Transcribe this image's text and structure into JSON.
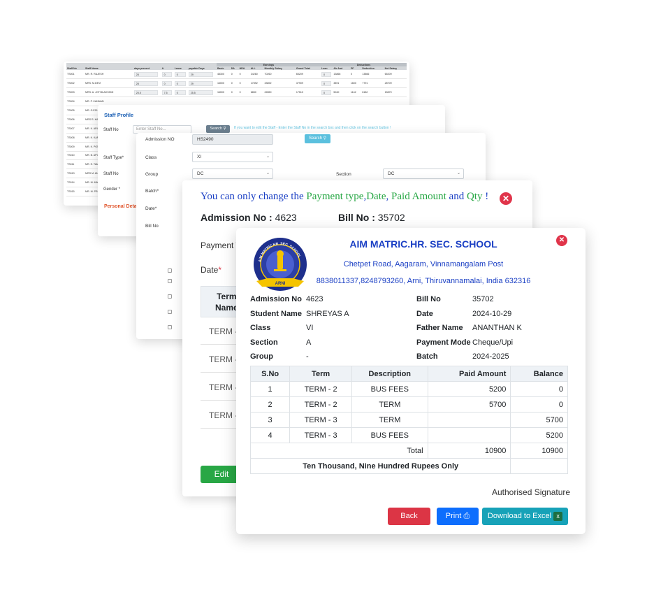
{
  "salary_table": {
    "group_earnings": "Earnings",
    "group_deductions": "Deductions",
    "columns": [
      "Staff No",
      "Staff Name",
      "days present",
      "A",
      "Leave",
      "payable Days",
      "Basic",
      "DA",
      "HRA",
      "ALL",
      "Monthly Salary",
      "Grand Total",
      "Loan",
      "Alr Amt",
      "PF",
      "Deduction",
      "Net Salary"
    ],
    "rows": [
      {
        "no": "TS001",
        "name": "MR. R. RAJESH",
        "present": "28",
        "a": "0",
        "leave": "0",
        "payable": "29",
        "basic": "48300",
        "da": "0",
        "hra": "0",
        "all": "34260",
        "monthly": "70260",
        "grand": "65209",
        "loan": "0",
        "alr": "13866",
        "pf": "0",
        "ded": "13866",
        "net": "65209"
      },
      {
        "no": "TS002",
        "name": "MRS. M.DEVI",
        "present": "28",
        "a": "0",
        "leave": "0",
        "payable": "29",
        "basic": "16000",
        "da": "0",
        "hra": "0",
        "all": "17892",
        "monthly": "33892",
        "grand": "37909",
        "loan": "0",
        "alr": "3891",
        "pf": "1600",
        "ded": "7791",
        "net": "28709"
      },
      {
        "no": "TS003",
        "name": "MRS. A. JOTHILAKSHMI",
        "present": "25.5",
        "a": "7.5",
        "leave": "0",
        "payable": "25.5",
        "basic": "16000",
        "da": "0",
        "hra": "0",
        "all": "6850",
        "monthly": "22850",
        "grand": "17510",
        "loan": "0",
        "alr": "5040",
        "pf": "1142",
        "ded": "6182",
        "net": "15870"
      },
      {
        "no": "TS004",
        "name": "MR. P. KANNAN"
      },
      {
        "no": "TS005",
        "name": "MR. G.EZHIL"
      },
      {
        "no": "TS006",
        "name": "MRS R. KAVITHA"
      },
      {
        "no": "TS007",
        "name": "MR. K. ARUN"
      },
      {
        "no": "TS008",
        "name": "MR. K. KARTHI"
      },
      {
        "no": "TS009",
        "name": "MR. K. PONNAN"
      },
      {
        "no": "TS010",
        "name": "MR. B. APOORVA"
      },
      {
        "no": "TS011",
        "name": "MR. E. TAMIL"
      },
      {
        "no": "TS013",
        "name": "MRS M. ANU"
      },
      {
        "no": "TS014",
        "name": "MR. M. MANI"
      },
      {
        "no": "TS015",
        "name": "MR. M. PRAKASH"
      }
    ]
  },
  "staff_profile": {
    "title": "Staff Profile",
    "staff_no_label": "Staff No",
    "staff_no_placeholder": "Enter Staff No...",
    "search_label": "Search",
    "hint": "If you want to edit the Staff - Enter the Staff No in the search box and then click on the search button !",
    "staff_type_label": "Staff Type*",
    "staff_no_label2": "Staff No",
    "gender_label": "Gender *",
    "personal_details": "Personal Deta"
  },
  "admission_form": {
    "admission_no_label": "Admission NO",
    "admission_no_value": "HS2490",
    "search_label": "Search",
    "class_label": "Class",
    "class_value": "XI",
    "group_label": "Group",
    "group_value": "DC",
    "section_label": "Section",
    "section_value": "DC",
    "batch_label": "Batch*",
    "date_label": "Date*",
    "bill_no_label": "Bill No"
  },
  "edit_dialog": {
    "notice_1": "You can only change the ",
    "notice_2": "Payment type",
    "notice_3": ",",
    "notice_4": "Date",
    "notice_5": ", ",
    "notice_6": "Paid Amount",
    "notice_7": " and ",
    "notice_8": "Qty",
    "notice_9": " !",
    "admission_label": "Admission No : ",
    "admission_value": "4623",
    "bill_label": "Bill No : ",
    "bill_value": "35702",
    "payment_label": "Payment T",
    "date_label": "Date",
    "required_mark": "*",
    "term_header_1": "Term",
    "term_header_2": "Name",
    "term_rows": [
      "TERM -",
      "TERM -",
      "TERM -",
      "TERM -"
    ],
    "edit_button": "Edit"
  },
  "receipt": {
    "school_name": "AIM MATRIC.HR. SEC. SCHOOL",
    "address_line": "Chetpet Road, Aagaram, Vinnamangalam Post",
    "contact_line": "8838011337,8248793260, Arni, Thiruvannamalai, India 632316",
    "logo_text_top": "AIM MATRIC HR. SEC. SCHOOL",
    "logo_banner": "ARNI",
    "fields_left": [
      {
        "label": "Admission No",
        "value": "4623"
      },
      {
        "label": "Student Name",
        "value": "SHREYAS A"
      },
      {
        "label": "Class",
        "value": "VI"
      },
      {
        "label": "Section",
        "value": "A"
      },
      {
        "label": "Group",
        "value": "-"
      }
    ],
    "fields_right": [
      {
        "label": "Bill No",
        "value": "35702"
      },
      {
        "label": "Date",
        "value": "2024-10-29"
      },
      {
        "label": "Father Name",
        "value": "ANANTHAN K"
      },
      {
        "label": "Payment Mode",
        "value": "Cheque/Upi"
      },
      {
        "label": "Batch",
        "value": "2024-2025"
      }
    ],
    "table_headers": [
      "S.No",
      "Term",
      "Description",
      "Paid Amount",
      "Balance"
    ],
    "rows": [
      {
        "sno": "1",
        "term": "TERM - 2",
        "desc": "BUS FEES",
        "paid": "5200",
        "bal": "0"
      },
      {
        "sno": "2",
        "term": "TERM - 2",
        "desc": "TERM",
        "paid": "5700",
        "bal": "0"
      },
      {
        "sno": "3",
        "term": "TERM - 3",
        "desc": "TERM",
        "paid": "",
        "bal": "5700"
      },
      {
        "sno": "4",
        "term": "TERM - 3",
        "desc": "BUS FEES",
        "paid": "",
        "bal": "5200"
      }
    ],
    "total_label": "Total",
    "total_paid": "10900",
    "total_balance": "10900",
    "amount_words": "Ten Thousand, Nine Hundred Rupees Only",
    "signature": "Authorised Signature",
    "back_button": "Back",
    "print_button": "Print",
    "excel_button": "Download to Excel",
    "excel_badge": "x"
  },
  "colors": {
    "blue": "#1a3fc4",
    "green": "#28a745",
    "red_close": "#e0344a",
    "back_red": "#dc3545",
    "print_blue": "#0d6efd",
    "excel_teal": "#17a2b8",
    "search_teal": "#5bc0de"
  }
}
